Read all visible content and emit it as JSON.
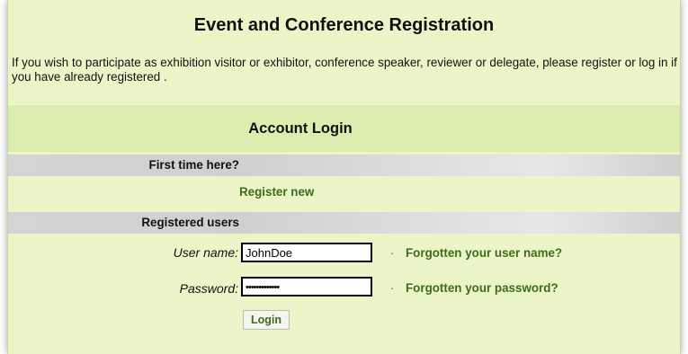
{
  "page": {
    "title": "Event and Conference Registration",
    "intro": "If you wish to participate as exhibition visitor or exhibitor, conference speaker, reviewer or delegate, please register or log in if you have already registered ."
  },
  "login": {
    "heading": "Account Login",
    "first_time": {
      "label": "First time here?",
      "register_link": "Register new"
    },
    "registered": {
      "label": "Registered users",
      "username_label": "User name:",
      "username_value": "JohnDoe",
      "password_label": "Password:",
      "password_value": "•••••••••••••",
      "forgot_username": "Forgotten your user name?",
      "forgot_password": "Forgotten your password?",
      "separator": "·",
      "submit_label": "Login"
    }
  },
  "colors": {
    "panel_bg": "#ecf5c8",
    "heading_band": "#dcedb0",
    "link": "#3e6b1c",
    "bar_gray": "#d4d4d4"
  }
}
